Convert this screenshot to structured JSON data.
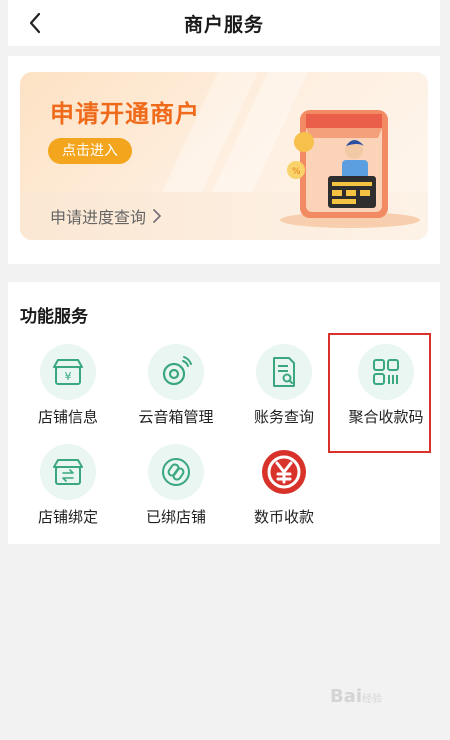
{
  "header": {
    "title": "商户服务"
  },
  "banner": {
    "title": "申请开通商户",
    "apply_label": "点击进入",
    "progress_label": "申请进度查询"
  },
  "services": {
    "section_title": "功能服务",
    "items": [
      {
        "label": "店铺信息",
        "icon": "store-info-icon"
      },
      {
        "label": "云音箱管理",
        "icon": "speaker-icon"
      },
      {
        "label": "账务查询",
        "icon": "bill-search-icon"
      },
      {
        "label": "聚合收款码",
        "icon": "qr-code-icon"
      },
      {
        "label": "店铺绑定",
        "icon": "store-bind-icon"
      },
      {
        "label": "已绑店铺",
        "icon": "link-icon"
      },
      {
        "label": "数币收款",
        "icon": "digital-yuan-icon"
      }
    ]
  },
  "watermark": {
    "text": "Bai",
    "suffix": "经验"
  },
  "colors": {
    "accent_orange": "#ef6a1a",
    "button_yellow": "#f3a51d",
    "icon_green": "#3aa77f",
    "icon_bg": "#e9f6f2",
    "highlight_red": "#d8322b",
    "digital_yuan_red": "#d8322b"
  }
}
